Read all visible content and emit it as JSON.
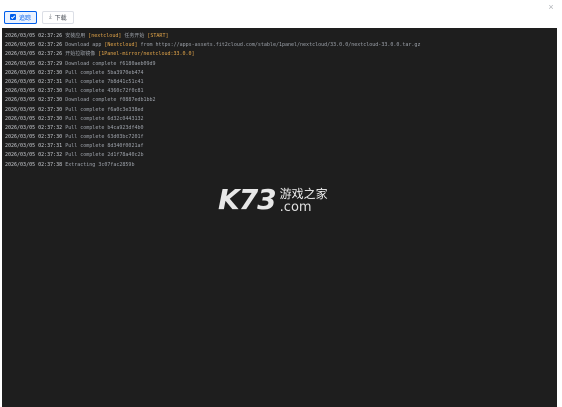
{
  "dialog": {
    "close_glyph": "×"
  },
  "toolbar": {
    "follow_label": "追踪",
    "download_label": "下载",
    "download_icon": "⤓"
  },
  "log": {
    "lines": [
      {
        "ts": "2026/03/05 02:37:26",
        "segments": [
          {
            "text": " 安装应用 ",
            "hl": false
          },
          {
            "text": "[nextcloud]",
            "hl": true
          },
          {
            "text": " 任务开始 ",
            "hl": false
          },
          {
            "text": "[START]",
            "hl": true
          }
        ]
      },
      {
        "ts": "2026/03/05 02:37:26",
        "segments": [
          {
            "text": " Download app ",
            "hl": false
          },
          {
            "text": "[Nextcloud]",
            "hl": true
          },
          {
            "text": " from https://apps-assets.fit2cloud.com/stable/1panel/nextcloud/33.0.0/nextcloud-33.0.0.tar.gz",
            "hl": false
          }
        ]
      },
      {
        "ts": "2026/03/05 02:37:26",
        "segments": [
          {
            "text": " 开始拉取镜像 ",
            "hl": false
          },
          {
            "text": "[1Panel-mirror/nextcloud:33.0.0]",
            "hl": true
          }
        ]
      },
      {
        "ts": "2026/03/05 02:37:29",
        "segments": [
          {
            "text": " Download complete f6180aeb09d9",
            "hl": false
          }
        ]
      },
      {
        "ts": "2026/03/05 02:37:30",
        "segments": [
          {
            "text": " Pull complete 5ba3970eb474",
            "hl": false
          }
        ]
      },
      {
        "ts": "2026/03/05 02:37:31",
        "segments": [
          {
            "text": " Pull complete 7b8d41c51c41",
            "hl": false
          }
        ]
      },
      {
        "ts": "2026/03/05 02:37:30",
        "segments": [
          {
            "text": " Pull complete 4360c72f0c81",
            "hl": false
          }
        ]
      },
      {
        "ts": "2026/03/05 02:37:30",
        "segments": [
          {
            "text": " Download complete f0887edb1bb2",
            "hl": false
          }
        ]
      },
      {
        "ts": "2026/03/05 02:37:30",
        "segments": [
          {
            "text": " Pull complete f6a0c3e338ed",
            "hl": false
          }
        ]
      },
      {
        "ts": "2026/03/05 02:37:30",
        "segments": [
          {
            "text": " Pull complete 6d32c0443132",
            "hl": false
          }
        ]
      },
      {
        "ts": "2026/03/05 02:37:32",
        "segments": [
          {
            "text": " Pull complete b4ca923df4b0",
            "hl": false
          }
        ]
      },
      {
        "ts": "2026/03/05 02:37:30",
        "segments": [
          {
            "text": " Pull complete 63d03bc7201f",
            "hl": false
          }
        ]
      },
      {
        "ts": "2026/03/05 02:37:31",
        "segments": [
          {
            "text": " Pull complete 8d340f0021af",
            "hl": false
          }
        ]
      },
      {
        "ts": "2026/03/05 02:37:32",
        "segments": [
          {
            "text": " Pull complete 2d1f78a40c2b",
            "hl": false
          }
        ]
      },
      {
        "ts": "2026/03/05 02:37:38",
        "segments": [
          {
            "text": " Extracting 3c07fac2859b",
            "hl": false
          }
        ]
      }
    ]
  },
  "watermark": {
    "logo": "K73",
    "cn": "游戏之家",
    "com": ".com"
  },
  "colors": {
    "accent": "#005eeb",
    "log_bg": "#1e1e1e",
    "log_text": "#9ea3ab",
    "log_highlight": "#e4a64a"
  }
}
